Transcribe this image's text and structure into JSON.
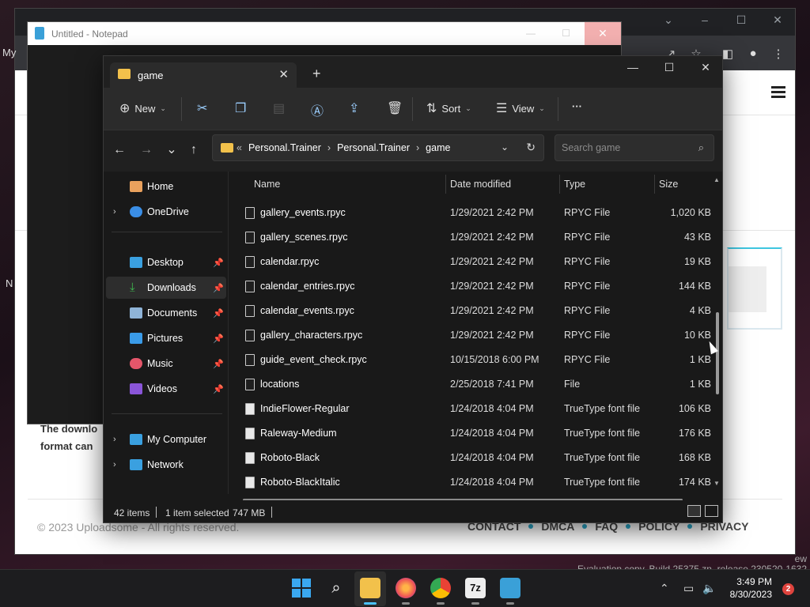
{
  "browser": {
    "left_fragments": [
      "My",
      "N"
    ],
    "article_text_lines": [
      "The downlo",
      "format can"
    ],
    "footer_copy": "© 2023 Uploadsome - All rights reserved.",
    "footer_links": [
      "CONTACT",
      "DMCA",
      "FAQ",
      "POLICY",
      "PRIVACY"
    ]
  },
  "notepad": {
    "title": "Untitled - Notepad"
  },
  "explorer": {
    "tab_title": "game",
    "toolbar": {
      "new_label": "New",
      "sort_label": "Sort",
      "view_label": "View",
      "more_label": "···"
    },
    "address": {
      "overflow": "«",
      "crumbs": [
        "Personal.Trainer",
        "Personal.Trainer",
        "game"
      ]
    },
    "search_placeholder": "Search game",
    "sidebar": {
      "items": [
        {
          "label": "Home",
          "icon": "home-icon",
          "color": "#e9a15d"
        },
        {
          "label": "OneDrive",
          "icon": "cloud-icon",
          "color": "#3a8ee6"
        },
        {
          "label": "Desktop",
          "icon": "desktop-icon",
          "color": "#3aa0e0"
        },
        {
          "label": "Downloads",
          "icon": "download-icon",
          "color": "#3fb950"
        },
        {
          "label": "Documents",
          "icon": "document-icon",
          "color": "#8fb4d8"
        },
        {
          "label": "Pictures",
          "icon": "picture-icon",
          "color": "#3a9be8"
        },
        {
          "label": "Music",
          "icon": "music-icon",
          "color": "#e5566a"
        },
        {
          "label": "Videos",
          "icon": "video-icon",
          "color": "#8a55d8"
        },
        {
          "label": "My Computer",
          "icon": "computer-icon",
          "color": "#3aa0e0"
        },
        {
          "label": "Network",
          "icon": "network-icon",
          "color": "#3aa0e0"
        }
      ]
    },
    "columns": {
      "name": "Name",
      "date": "Date modified",
      "type": "Type",
      "size": "Size"
    },
    "files": [
      {
        "name": "gallery_events.rpyc",
        "date": "1/29/2021 2:42 PM",
        "type": "RPYC File",
        "size": "1,020 KB",
        "kind": "file"
      },
      {
        "name": "gallery_scenes.rpyc",
        "date": "1/29/2021 2:42 PM",
        "type": "RPYC File",
        "size": "43 KB",
        "kind": "file"
      },
      {
        "name": "calendar.rpyc",
        "date": "1/29/2021 2:42 PM",
        "type": "RPYC File",
        "size": "19 KB",
        "kind": "file"
      },
      {
        "name": "calendar_entries.rpyc",
        "date": "1/29/2021 2:42 PM",
        "type": "RPYC File",
        "size": "144 KB",
        "kind": "file"
      },
      {
        "name": "calendar_events.rpyc",
        "date": "1/29/2021 2:42 PM",
        "type": "RPYC File",
        "size": "4 KB",
        "kind": "file"
      },
      {
        "name": "gallery_characters.rpyc",
        "date": "1/29/2021 2:42 PM",
        "type": "RPYC File",
        "size": "10 KB",
        "kind": "file"
      },
      {
        "name": "guide_event_check.rpyc",
        "date": "10/15/2018 6:00 PM",
        "type": "RPYC File",
        "size": "1 KB",
        "kind": "file"
      },
      {
        "name": "locations",
        "date": "2/25/2018 7:41 PM",
        "type": "File",
        "size": "1 KB",
        "kind": "file"
      },
      {
        "name": "IndieFlower-Regular",
        "date": "1/24/2018 4:04 PM",
        "type": "TrueType font file",
        "size": "106 KB",
        "kind": "font"
      },
      {
        "name": "Raleway-Medium",
        "date": "1/24/2018 4:04 PM",
        "type": "TrueType font file",
        "size": "176 KB",
        "kind": "font"
      },
      {
        "name": "Roboto-Black",
        "date": "1/24/2018 4:04 PM",
        "type": "TrueType font file",
        "size": "168 KB",
        "kind": "font"
      },
      {
        "name": "Roboto-BlackItalic",
        "date": "1/24/2018 4:04 PM",
        "type": "TrueType font file",
        "size": "174 KB",
        "kind": "font"
      }
    ],
    "status": {
      "items": "42 items",
      "selected": "1 item selected",
      "size": "747 MB"
    }
  },
  "taskbar": {
    "time": "3:49 PM",
    "date": "8/30/2023",
    "notification_count": "2",
    "apps": [
      "start-icon",
      "search-icon",
      "file-explorer-icon",
      "firefox-icon",
      "chrome-icon",
      "7zip-icon",
      "notepad-icon"
    ],
    "sevenzip_label": "7z"
  },
  "watermark": {
    "line1": "ew",
    "line2": "Evaluation copy. Build 25375.zn_release.230520-1632"
  }
}
